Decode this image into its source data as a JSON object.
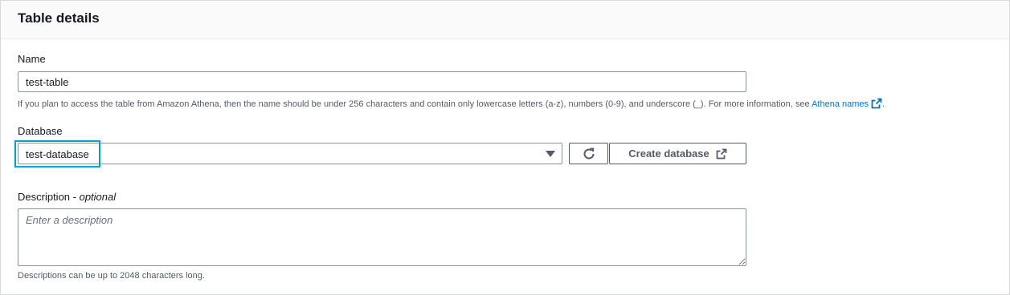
{
  "panel": {
    "title": "Table details"
  },
  "name_field": {
    "label": "Name",
    "value": "test-table",
    "hint": "If you plan to access the table from Amazon Athena, then the name should be under 256 characters and contain only lowercase letters (a-z), numbers (0-9), and underscore (_). For more information, see ",
    "hint_link": "Athena names",
    "hint_link_icon": "external-link-icon"
  },
  "database_field": {
    "label": "Database",
    "selected": "test-database",
    "refresh_icon": "refresh-icon",
    "create_button": "Create database",
    "create_button_icon": "external-link-icon"
  },
  "description_field": {
    "label": "Description",
    "label_suffix": " - ",
    "optional": "optional",
    "placeholder": "Enter a description",
    "hint": "Descriptions can be up to 2048 characters long."
  },
  "colors": {
    "link": "#0073bb",
    "focus": "#00a1c9",
    "border": "#879596"
  }
}
